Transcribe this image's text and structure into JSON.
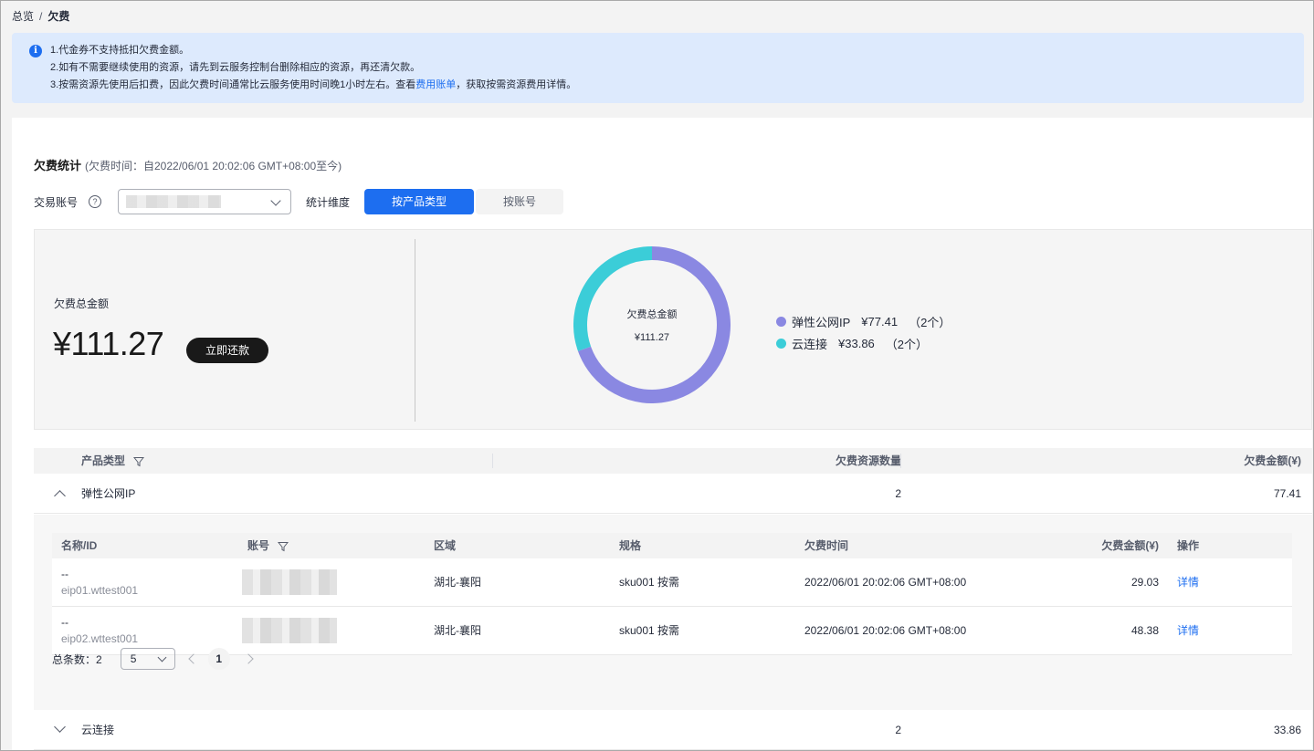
{
  "breadcrumb": {
    "root": "总览",
    "sep": "/",
    "current": "欠费"
  },
  "notice": {
    "line1": "1.代金券不支持抵扣欠费金额。",
    "line2": "2.如有不需要继续使用的资源，请先到云服务控制台删除相应的资源，再还清欠款。",
    "line3_pre": "3.按需资源先使用后扣费，因此欠费时间通常比云服务使用时间晚1小时左右。查看",
    "line3_link": "费用账单",
    "line3_post": "，获取按需资源费用详情。"
  },
  "stats": {
    "title": "欠费统计",
    "subtitle": "(欠费时间：自2022/06/01 20:02:06 GMT+08:00至今)",
    "account_label": "交易账号",
    "dimension_label": "统计维度",
    "dim_product": "按产品类型",
    "dim_account": "按账号"
  },
  "summary": {
    "total_label": "欠费总金额",
    "total_amount": "¥111.27",
    "pay_button": "立即还款",
    "donut_label": "欠费总金额",
    "donut_amount": "¥111.27",
    "legend": [
      {
        "name": "弹性公网IP",
        "amount": "¥77.41",
        "count": "（2个）",
        "color": "#8a88e2",
        "value": 77.41
      },
      {
        "name": "云连接",
        "amount": "¥33.86",
        "count": "（2个）",
        "color": "#3bcdd8",
        "value": 33.86
      }
    ]
  },
  "table": {
    "col_type": "产品类型",
    "col_count": "欠费资源数量",
    "col_amount": "欠费金额(¥)",
    "groups": [
      {
        "name": "弹性公网IP",
        "count": "2",
        "amount": "77.41"
      },
      {
        "name": "云连接",
        "count": "2",
        "amount": "33.86"
      }
    ]
  },
  "subtable": {
    "col_name": "名称/ID",
    "col_account": "账号",
    "col_region": "区域",
    "col_spec": "规格",
    "col_time": "欠费时间",
    "col_amount": "欠费金额(¥)",
    "col_op": "操作",
    "rows": [
      {
        "name": "--",
        "id": "eip01.wttest001",
        "region": "湖北-襄阳",
        "spec": "sku001 按需",
        "time": "2022/06/01 20:02:06 GMT+08:00",
        "amount": "29.03",
        "op": "详情"
      },
      {
        "name": "--",
        "id": "eip02.wttest001",
        "region": "湖北-襄阳",
        "spec": "sku001 按需",
        "time": "2022/06/01 20:02:06 GMT+08:00",
        "amount": "48.38",
        "op": "详情"
      }
    ]
  },
  "pager": {
    "total_label": "总条数：2",
    "page_size": "5",
    "page": "1"
  }
}
